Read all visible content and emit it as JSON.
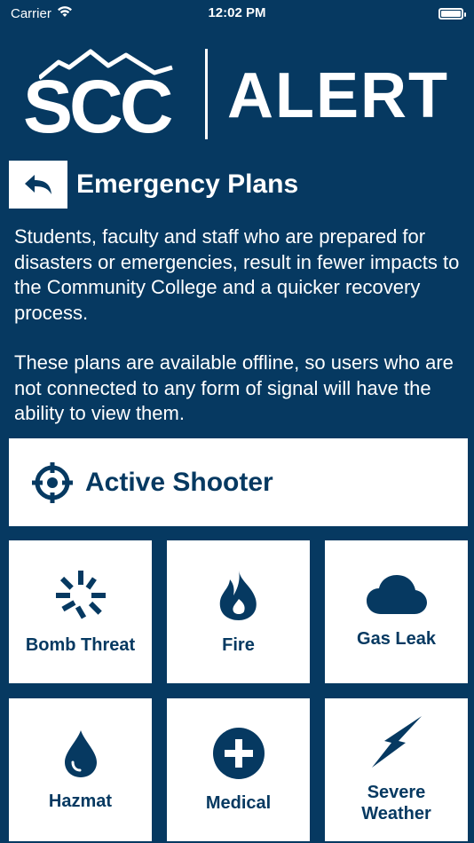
{
  "status_bar": {
    "carrier": "Carrier",
    "time": "12:02 PM"
  },
  "logo": {
    "left_text": "SCC",
    "right_text": "ALERT"
  },
  "header": {
    "title": "Emergency Plans"
  },
  "intro": {
    "paragraph1": "Students, faculty and staff who are prepared for disasters or emergencies, result in fewer impacts to the Community College and a quicker recovery process.",
    "paragraph2": "These plans are available offline, so users who are not connected to any form of signal will have the ability to view them."
  },
  "plans": {
    "featured": {
      "label": "Active Shooter",
      "icon": "crosshair-icon"
    },
    "grid": [
      {
        "label": "Bomb Threat",
        "icon": "burst-icon"
      },
      {
        "label": "Fire",
        "icon": "flame-icon"
      },
      {
        "label": "Gas Leak",
        "icon": "cloud-icon"
      },
      {
        "label": "Hazmat",
        "icon": "droplet-icon"
      },
      {
        "label": "Medical",
        "icon": "medical-cross-icon"
      },
      {
        "label": "Severe Weather",
        "icon": "lightning-icon"
      }
    ]
  },
  "colors": {
    "background": "#063961",
    "tile": "#ffffff",
    "accent": "#063961"
  }
}
